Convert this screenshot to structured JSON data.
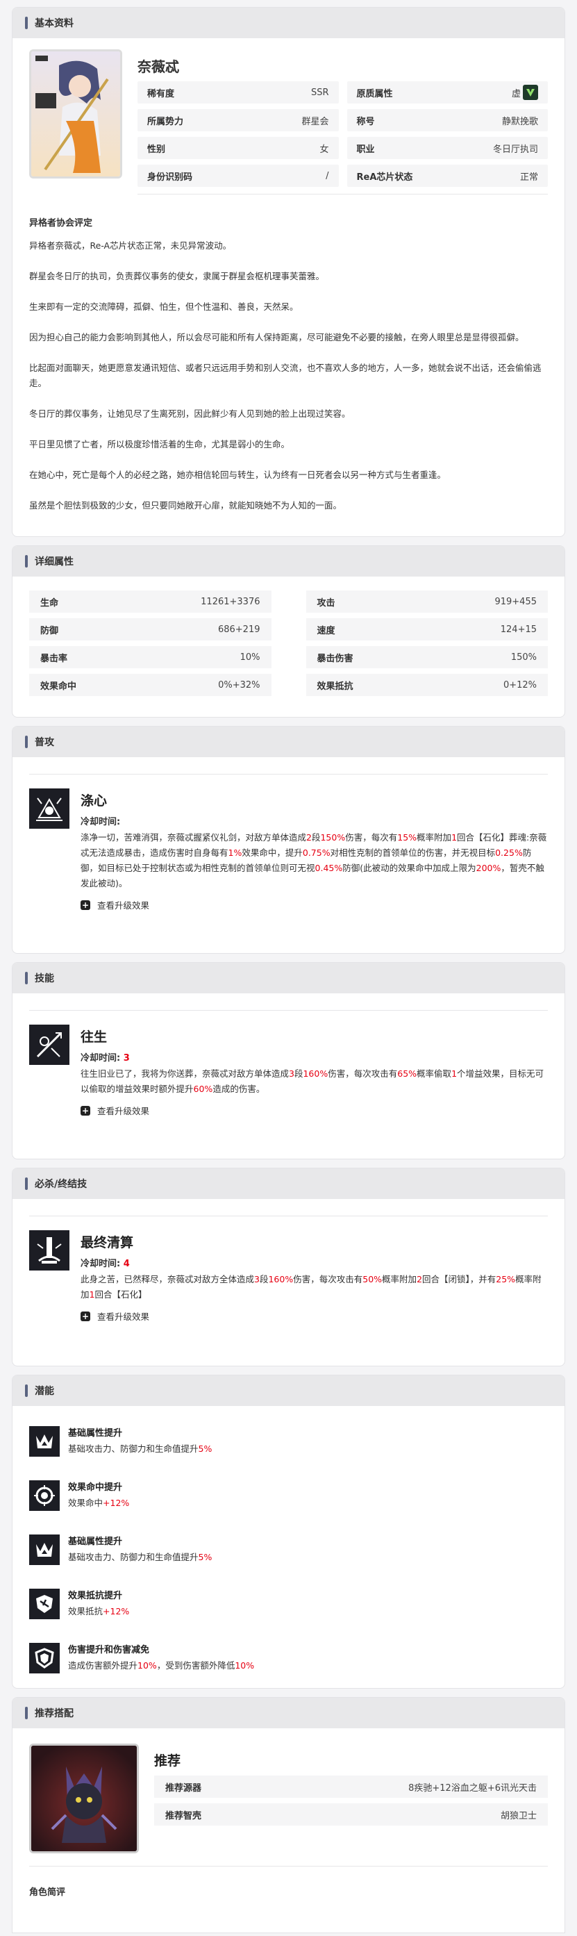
{
  "basic": {
    "section_title": "基本资料",
    "name": "奈薇忒",
    "fields": {
      "rarity_k": "稀有度",
      "rarity_v": "SSR",
      "attr_k": "原质属性",
      "attr_v": "虚",
      "faction_k": "所属势力",
      "faction_v": "群星会",
      "title_k": "称号",
      "title_v": "静默挽歌",
      "gender_k": "性别",
      "gender_v": "女",
      "job_k": "职业",
      "job_v": "冬日厅执司",
      "idcode_k": "身份识别码",
      "idcode_v": "/",
      "chip_k": "ReA芯片状态",
      "chip_v": "正常"
    },
    "eval_title": "异格者协会评定",
    "eval_paragraphs": [
      "异格者奈薇忒，Re-A芯片状态正常，未见异常波动。",
      "群星会冬日厅的执司，负责葬仪事务的使女，隶属于群星会枢机理事芙蕾雅。",
      "生来即有一定的交流障碍，孤僻、怕生，但个性温和、善良，天然呆。",
      "因为担心自己的能力会影响到其他人，所以会尽可能和所有人保持距离，尽可能避免不必要的接触，在旁人眼里总是显得很孤僻。",
      "比起面对面聊天，她更愿意发通讯短信、或者只远远用手势和别人交流，也不喜欢人多的地方，人一多，她就会说不出话，还会偷偷逃走。",
      "冬日厅的葬仪事务，让她见尽了生离死别，因此鲜少有人见到她的脸上出现过笑容。",
      "平日里见惯了亡者，所以极度珍惜活着的生命，尤其是弱小的生命。",
      "在她心中，死亡是每个人的必经之路，她亦相信轮回与转生，认为终有一日死者会以另一种方式与生者重逢。",
      "虽然是个胆怯到极致的少女，但只要同她敞开心扉，就能知晓她不为人知的一面。"
    ]
  },
  "stats": {
    "section_title": "详细属性",
    "items": [
      {
        "k": "生命",
        "v": "11261+3376"
      },
      {
        "k": "攻击",
        "v": "919+455"
      },
      {
        "k": "防御",
        "v": "686+219"
      },
      {
        "k": "速度",
        "v": "124+15"
      },
      {
        "k": "暴击率",
        "v": "10%"
      },
      {
        "k": "暴击伤害",
        "v": "150%"
      },
      {
        "k": "效果命中",
        "v": "0%+32%"
      },
      {
        "k": "效果抵抗",
        "v": "0+12%"
      }
    ]
  },
  "normal_attack": {
    "section_title": "普攻",
    "name": "涤心",
    "cd_label": "冷却时间:",
    "cd_value": "",
    "d1": "涤净一切，苦难消弭，奈薇忒握紧仪礼剑，对敌方单体造成",
    "d2": "2",
    "d3": "段",
    "d4": "150%",
    "d5": "伤害，每次有",
    "d6": "15%",
    "d7": "概率附加",
    "d8": "1",
    "d9": "回合【石化】葬魂:奈薇忒无法造成暴击，造成伤害时自身每有",
    "d10": "1%",
    "d11": "效果命中，提升",
    "d12": "0.75%",
    "d13": "对相性克制的首领单位的伤害，并无视目标",
    "d14": "0.25%",
    "d15": "防御，如目标已处于控制状态或为相性克制的首领单位则可无视",
    "d16": "0.45%",
    "d17": "防御(此被动的效果命中加成上限为",
    "d18": "200%",
    "d19": "，暂壳不触发此被动)。",
    "upgrade": "查看升级效果"
  },
  "skill": {
    "section_title": "技能",
    "name": "往生",
    "cd_label": "冷却时间:",
    "cd_value": "3",
    "d1": "往生旧业已了，我将为你送葬，奈薇忒对敌方单体造成",
    "d2": "3",
    "d3": "段",
    "d4": "160%",
    "d5": "伤害，每次攻击有",
    "d6": "65%",
    "d7": "概率偷取",
    "d8": "1",
    "d9": "个增益效果，目标无可以偷取的增益效果时额外提升",
    "d10": "60%",
    "d11": "造成的伤害。",
    "upgrade": "查看升级效果"
  },
  "ultimate": {
    "section_title": "必杀/终结技",
    "name": "最终清算",
    "cd_label": "冷却时间:",
    "cd_value": "4",
    "d1": "此身之苦，已然释尽，奈薇忒对敌方全体造成",
    "d2": "3",
    "d3": "段",
    "d4": "160%",
    "d5": "伤害，每次攻击有",
    "d6": "50%",
    "d7": "概率附加",
    "d8": "2",
    "d9": "回合【闭锁】，并有",
    "d10": "25%",
    "d11": "概率附加",
    "d12": "1",
    "d13": "回合【石化】",
    "upgrade": "查看升级效果"
  },
  "potential": {
    "section_title": "潜能",
    "items": [
      {
        "name": "基础属性提升",
        "pre": "基础攻击力、防御力和生命值提升",
        "val": "5%",
        "post": ""
      },
      {
        "name": "效果命中提升",
        "pre": "效果命中",
        "val": "+12%",
        "post": ""
      },
      {
        "name": "基础属性提升",
        "pre": "基础攻击力、防御力和生命值提升",
        "val": "5%",
        "post": ""
      },
      {
        "name": "效果抵抗提升",
        "pre": "效果抵抗",
        "val": "+12%",
        "post": ""
      },
      {
        "name": "伤害提升和伤害减免",
        "pre": "造成伤害额外提升",
        "val": "10%",
        "post": "，受到伤害额外降低",
        "val2": "10%"
      }
    ]
  },
  "recommend": {
    "section_title": "推荐搭配",
    "title": "推荐",
    "row1_k": "推荐源器",
    "row1_v": "8疾驰+12浴血之躯+6讯光天击",
    "row2_k": "推荐智壳",
    "row2_v": "胡狼卫士",
    "review_title": "角色简评"
  }
}
